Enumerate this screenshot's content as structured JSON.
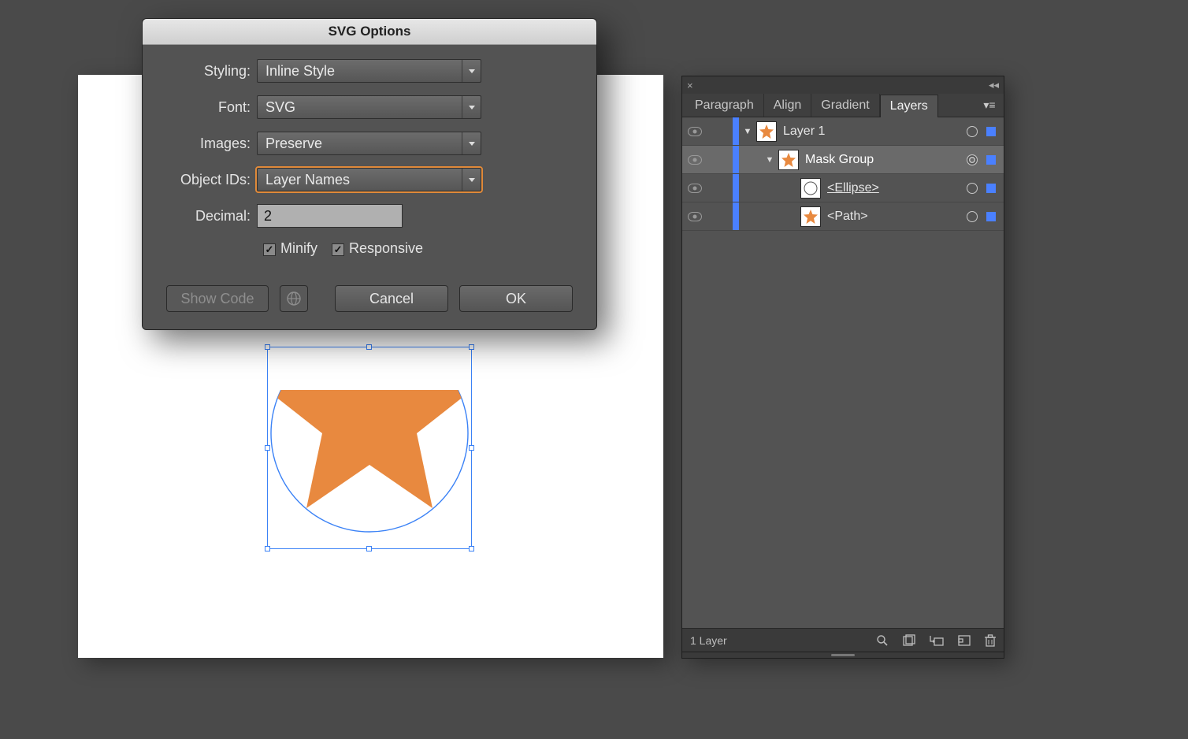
{
  "dialog": {
    "title": "SVG Options",
    "labels": {
      "styling": "Styling:",
      "font": "Font:",
      "images": "Images:",
      "object_ids": "Object IDs:",
      "decimal": "Decimal:"
    },
    "values": {
      "styling": "Inline Style",
      "font": "SVG",
      "images": "Preserve",
      "object_ids": "Layer Names",
      "decimal": "2"
    },
    "checks": {
      "minify_label": "Minify",
      "minify_checked": true,
      "responsive_label": "Responsive",
      "responsive_checked": true
    },
    "buttons": {
      "show_code": "Show Code",
      "cancel": "Cancel",
      "ok": "OK"
    }
  },
  "panel": {
    "close_glyph": "×",
    "collapse_glyph": "◂◂",
    "tabs": [
      "Paragraph",
      "Align",
      "Gradient",
      "Layers"
    ],
    "active_tab": "Layers",
    "menu_glyph": "▾≡",
    "layers": [
      {
        "indent": 0,
        "toggle": "▼",
        "name": "Layer 1",
        "thumb": "star",
        "selected": false,
        "clip": false,
        "target": "single"
      },
      {
        "indent": 1,
        "toggle": "▼",
        "name": "Mask Group",
        "thumb": "star",
        "selected": true,
        "clip": false,
        "target": "double"
      },
      {
        "indent": 2,
        "toggle": "",
        "name": "<Ellipse>",
        "thumb": "ellipse",
        "selected": false,
        "clip": true,
        "target": "single"
      },
      {
        "indent": 2,
        "toggle": "",
        "name": "<Path>",
        "thumb": "star",
        "selected": false,
        "clip": false,
        "target": "single"
      }
    ],
    "footer": {
      "count": "1 Layer"
    }
  },
  "colors": {
    "accent_orange": "#e8893f",
    "selection_blue": "#3b82f6",
    "layer_edge_blue": "#4a80ff"
  }
}
